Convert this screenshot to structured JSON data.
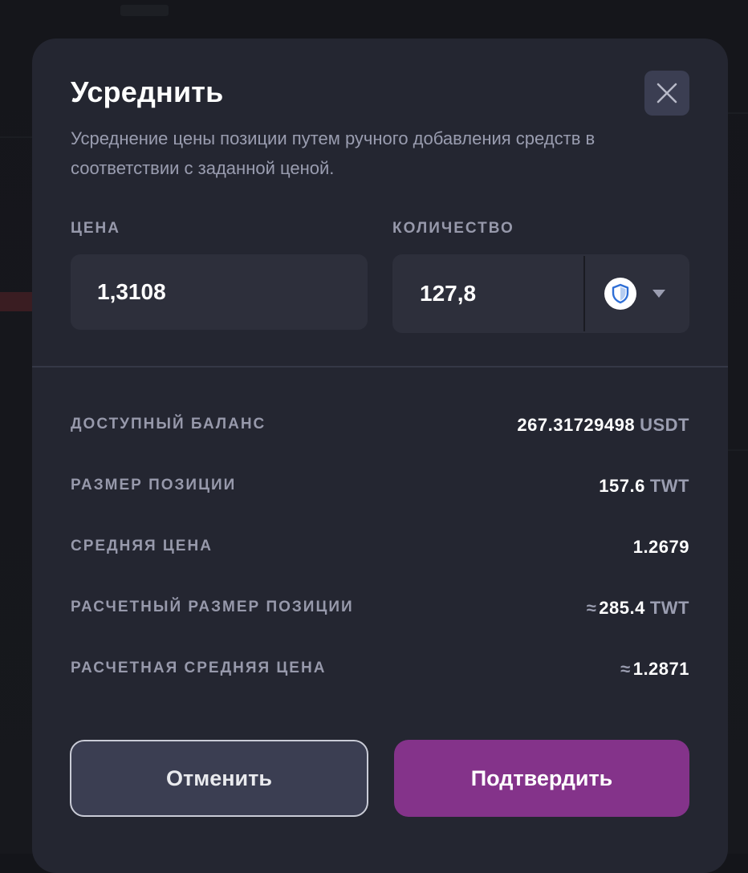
{
  "dialog": {
    "title": "Усреднить",
    "description": "Усреднение цены позиции путем ручного добавления средств в соответствии с заданной ценой."
  },
  "form": {
    "price_label": "ЦЕНА",
    "price_value": "1,3108",
    "quantity_label": "КОЛИЧЕСТВО",
    "quantity_value": "127,8",
    "token_icon": "shield-icon"
  },
  "info": {
    "available_balance": {
      "label": "ДОСТУПНЫЙ БАЛАНС",
      "value": "267.31729498",
      "unit": "USDT"
    },
    "position_size": {
      "label": "РАЗМЕР ПОЗИЦИИ",
      "value": "157.6",
      "unit": "TWT"
    },
    "average_price": {
      "label": "СРЕДНЯЯ ЦЕНА",
      "value": "1.2679"
    },
    "est_position_size": {
      "label": "РАСЧЕТНЫЙ РАЗМЕР ПОЗИЦИИ",
      "approx": "≈",
      "value": "285.4",
      "unit": "TWT"
    },
    "est_average_price": {
      "label": "РАСЧЕТНАЯ СРЕДНЯЯ ЦЕНА",
      "approx": "≈",
      "value": "1.2871"
    }
  },
  "buttons": {
    "cancel": "Отменить",
    "confirm": "Подтвердить"
  },
  "colors": {
    "modal_bg": "#242631",
    "input_bg": "#2d2f3b",
    "confirm": "#84338a",
    "cancel": "#3b3e52",
    "muted_text": "#9799ab"
  }
}
